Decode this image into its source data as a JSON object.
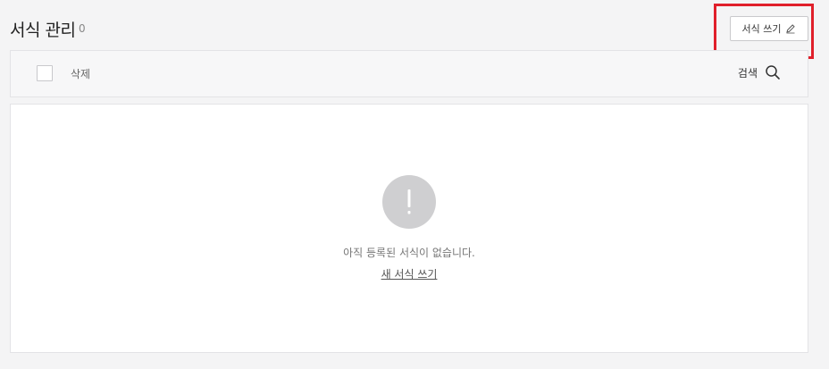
{
  "header": {
    "title": "서식 관리",
    "count": "0",
    "write_button_label": "서식 쓰기"
  },
  "toolbar": {
    "delete_label": "삭제",
    "search_label": "검색"
  },
  "empty_state": {
    "message": "아직 등록된 서식이 없습니다.",
    "new_link_label": "새 서식 쓰기"
  },
  "icons": {
    "write": "pencil-icon",
    "search": "search-icon",
    "alert": "exclamation-icon"
  },
  "colors": {
    "highlight": "#e0202b",
    "page_bg": "#f4f4f5",
    "alert_circle": "#cfcfd1"
  }
}
